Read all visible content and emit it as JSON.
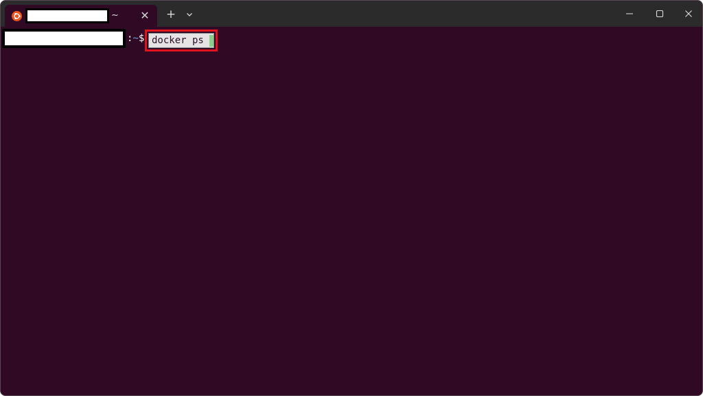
{
  "tab": {
    "icon": "ubuntu-icon",
    "title_suffix": "~",
    "close_label": "✕"
  },
  "tabbar": {
    "new_tab_label": "+",
    "dropdown_icon": "chevron-down-icon"
  },
  "window_controls": {
    "minimize_icon": "minimize-icon",
    "maximize_icon": "maximize-icon",
    "close_icon": "close-icon"
  },
  "terminal": {
    "prompt_colon": ":",
    "prompt_path": "~",
    "prompt_symbol": "$",
    "command": "docker ps"
  },
  "colors": {
    "terminal_bg": "#300a24",
    "titlebar_bg": "#2b2b2b",
    "highlight_border": "#e0141e",
    "ubuntu_orange": "#e95420",
    "cursor": "#8ad088"
  }
}
